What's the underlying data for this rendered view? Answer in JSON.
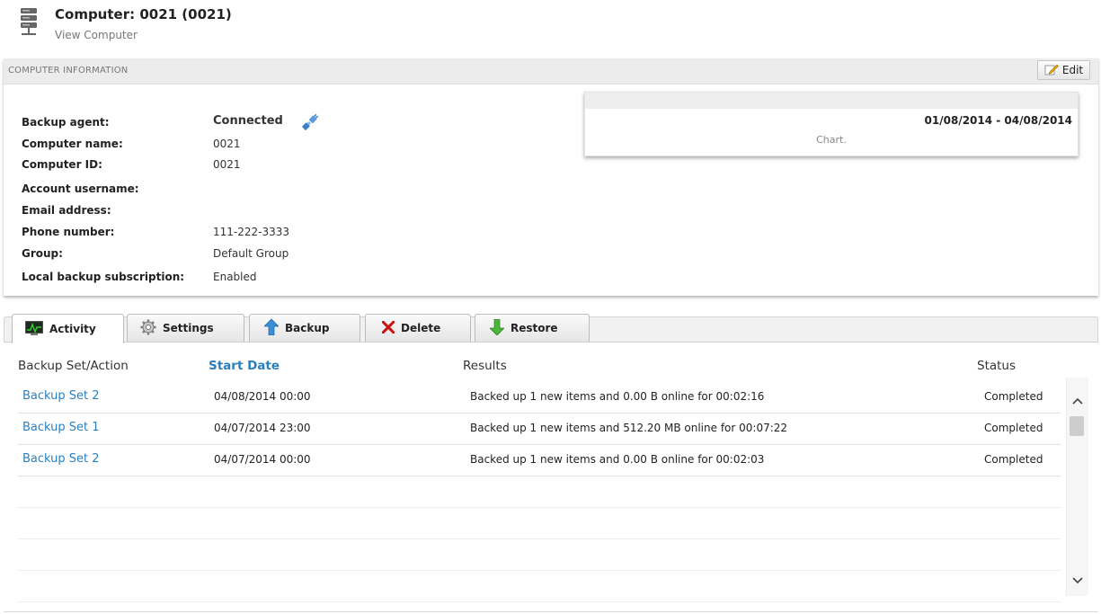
{
  "header": {
    "title": "Computer: 0021 (0021)",
    "subtitle": "View Computer",
    "icon": "server-icon"
  },
  "info_panel": {
    "section_label": "COMPUTER INFORMATION",
    "edit_label": "Edit",
    "fields": [
      {
        "label": "Backup agent:",
        "value": "Connected"
      },
      {
        "label": "Computer name:",
        "value": "0021"
      },
      {
        "label": "Computer ID:",
        "value": "0021"
      },
      {
        "label": "Account username:",
        "value": ""
      },
      {
        "label": "Email address:",
        "value": ""
      },
      {
        "label": "Phone number:",
        "value": "111-222-3333"
      },
      {
        "label": "Group:",
        "value": "Default Group"
      },
      {
        "label": "Local backup subscription:",
        "value": "Enabled"
      }
    ],
    "chart_box": {
      "date_range": "01/08/2014 - 04/08/2014",
      "placeholder": "Chart."
    }
  },
  "tabs": [
    {
      "label": "Activity",
      "icon": "activity-monitor-icon",
      "active": true
    },
    {
      "label": "Settings",
      "icon": "gear-icon",
      "active": false
    },
    {
      "label": "Backup",
      "icon": "up-arrow-icon",
      "active": false
    },
    {
      "label": "Delete",
      "icon": "red-x-icon",
      "active": false
    },
    {
      "label": "Restore",
      "icon": "down-arrow-icon",
      "active": false
    }
  ],
  "table": {
    "columns": [
      "Backup Set/Action",
      "Start Date",
      "Results",
      "Status"
    ],
    "sorted_column": "Start Date",
    "rows": [
      {
        "set": "Backup Set 2",
        "start": "04/08/2014 00:00",
        "results": "Backed up 1 new items and 0.00 B online for 00:02:16",
        "status": "Completed"
      },
      {
        "set": "Backup Set 1",
        "start": "04/07/2014 23:00",
        "results": "Backed up 1 new items and 512.20 MB online for 00:07:22",
        "status": "Completed"
      },
      {
        "set": "Backup Set 2",
        "start": "04/07/2014 00:00",
        "results": "Backed up 1 new items and 0.00 B online for 00:02:03",
        "status": "Completed"
      }
    ]
  },
  "colors": {
    "link": "#2a7fc0",
    "panel_bar": "#ececec",
    "delete_icon": "#cc1111",
    "backup_icon": "#3a8fd8",
    "restore_icon": "#4bb43c"
  }
}
